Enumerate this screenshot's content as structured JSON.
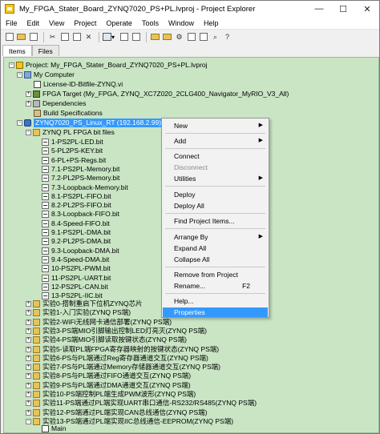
{
  "window": {
    "title": "My_FPGA_Stater_Board_ZYNQ7020_PS+PL.lvproj - Project Explorer",
    "minimize": "—",
    "maximize": "☐",
    "close": "✕"
  },
  "menubar": [
    "File",
    "Edit",
    "View",
    "Project",
    "Operate",
    "Tools",
    "Window",
    "Help"
  ],
  "tabs": [
    "Items",
    "Files"
  ],
  "tree": {
    "project": "Project: My_FPGA_Stater_Board_ZYNQ7020_PS+PL.lvproj",
    "my_computer": "My Computer",
    "license": "License-ID-Bitfile-ZYNQ.vi",
    "fpga_target": "FPGA Target (My_FPGA, ZYNQ_XC7Z020_2CLG400_Navigator_MyRIO_V3_All)",
    "dependencies": "Dependencies",
    "build_specs": "Build Specifications",
    "target": "ZYNQ7020_PS_Linux_RT (192.168.2.99)",
    "bit_folder": "ZYNQ PL FPGA bit files",
    "bit_files": [
      "1-PS2PL-LED.bit",
      "5-PL2PS-KEY.bit",
      "6-PL+PS-Regs.bit",
      "7.1-PS2PL-Memory.bit",
      "7.2-PL2PS-Memory.bit",
      "7.3-Loopback-Memory.bit",
      "8.1-PS2PL-FIFO.bit",
      "8.2-PL2PS-FIFO.bit",
      "8.3-Loopback-FIFO.bit",
      "8.4-Speed-FIFO.bit",
      "9.1-PS2PL-DMA.bit",
      "9.2-PL2PS-DMA.bit",
      "9.3-Loopback-DMA.bit",
      "9.4-Speed-DMA.bit",
      "10-PS2PL-PWM.bit",
      "11-PS2PL-UART.bit",
      "12-PS2PL-CAN.bit",
      "13-PS2PL-IIC.bit"
    ],
    "experiments": [
      "实验0-搭制重启下位机ZYNQ芯片",
      "实验1-入门实验(ZYNQ PS端)",
      "实验2-WiFi无线网卡通信部署(ZYNQ PS端)",
      "实验3-PS端MIO引脚输出控制LED灯亮灭(ZYNQ PS端)",
      "实验4-PS端MIO引脚读取按键状态(ZYNQ PS端)",
      "实验5-读取PL端FPGA寄存器映射的按键状态(ZYNQ PS端)",
      "实验6-PS与PL端通过Reg寄存器通道交互(ZYNQ PS端)",
      "实验7-PS与PL端通过Memory存储器通道交互(ZYNQ PS端)",
      "实验8-PS与PL端通过FIFO通道交互(ZYNQ PS端)",
      "实验9-PS与PL端通过DMA通道交互(ZYNQ PS端)",
      "实验10-PS端控制PL端生成PWM波形(ZYNQ PS端)",
      "实验11-PS端通过PL端实现UART串口通信-RS232/RS485(ZYNQ PS端)",
      "实验12-PS端通过PL端实现CAN总线通信(ZYNQ PS端)",
      "实验13-PS端通过PL端实现IIC总线通信-EEPROM(ZYNQ PS端)"
    ],
    "main": "Main"
  },
  "context_menu": {
    "new": "New",
    "add": "Add",
    "connect": "Connect",
    "disconnect": "Disconnect",
    "utilities": "Utilities",
    "deploy": "Deploy",
    "deploy_all": "Deploy All",
    "find_project_items": "Find Project Items...",
    "arrange_by": "Arrange By",
    "expand_all": "Expand All",
    "collapse_all": "Collapse All",
    "remove_from_project": "Remove from Project",
    "rename": "Rename...",
    "rename_shortcut": "F2",
    "help": "Help...",
    "properties": "Properties"
  },
  "colors": {
    "tree_background": "#c9e5c4",
    "selection": "#3399ff"
  }
}
